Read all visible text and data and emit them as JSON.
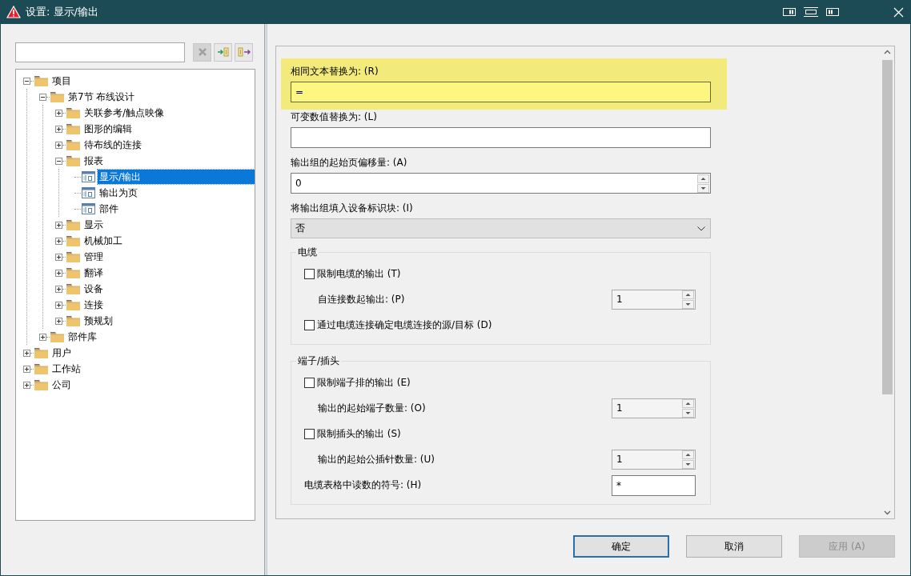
{
  "window": {
    "title": "设置: 显示/输出"
  },
  "filter_toolbar": [
    {
      "kind": "clear",
      "disabled": true
    },
    {
      "kind": "expand",
      "disabled": false
    },
    {
      "kind": "collapse",
      "disabled": false
    }
  ],
  "tree": [
    {
      "label": "项目",
      "kind": "folder",
      "expanded": true,
      "selected": false,
      "children": [
        {
          "label": "第7节 布线设计",
          "kind": "folder",
          "expanded": true,
          "selected": false,
          "children": [
            {
              "label": "关联参考/触点映像",
              "kind": "folder",
              "expanded": false,
              "selected": false
            },
            {
              "label": "图形的编辑",
              "kind": "folder",
              "expanded": false,
              "selected": false
            },
            {
              "label": "待布线的连接",
              "kind": "folder",
              "expanded": false,
              "selected": false
            },
            {
              "label": "报表",
              "kind": "folder",
              "expanded": true,
              "selected": false,
              "children": [
                {
                  "label": "显示/输出",
                  "kind": "page",
                  "selected": true
                },
                {
                  "label": "输出为页",
                  "kind": "page",
                  "selected": false
                },
                {
                  "label": "部件",
                  "kind": "page",
                  "selected": false
                }
              ]
            },
            {
              "label": "显示",
              "kind": "folder",
              "expanded": false,
              "selected": false
            },
            {
              "label": "机械加工",
              "kind": "folder",
              "expanded": false,
              "selected": false
            },
            {
              "label": "管理",
              "kind": "folder",
              "expanded": false,
              "selected": false
            },
            {
              "label": "翻译",
              "kind": "folder",
              "expanded": false,
              "selected": false
            },
            {
              "label": "设备",
              "kind": "folder",
              "expanded": false,
              "selected": false
            },
            {
              "label": "连接",
              "kind": "folder",
              "expanded": false,
              "selected": false
            },
            {
              "label": "预规划",
              "kind": "folder",
              "expanded": false,
              "selected": false
            }
          ]
        },
        {
          "label": "部件库",
          "kind": "folder",
          "expanded": false,
          "selected": false
        }
      ]
    },
    {
      "label": "用户",
      "kind": "folder",
      "expanded": false,
      "selected": false
    },
    {
      "label": "工作站",
      "kind": "folder",
      "expanded": false,
      "selected": false
    },
    {
      "label": "公司",
      "kind": "folder",
      "expanded": false,
      "selected": false
    }
  ],
  "form": [
    {
      "kind": "text",
      "label": "相同文本替换为: (R)",
      "value": "=",
      "highlighted": true
    },
    {
      "kind": "text",
      "label": "可变数值替换为: (L)",
      "highlighted": false
    },
    {
      "kind": "spin",
      "label": "输出组的起始页偏移量: (A)",
      "value": "0"
    },
    {
      "kind": "select",
      "label": "将输出组填入设备标识块: (I)",
      "value": "否"
    },
    {
      "kind": "group",
      "title": "电缆",
      "items": [
        {
          "kind": "checkbox",
          "label": "限制电缆的输出 (T)",
          "checked": false
        },
        {
          "kind": "spin",
          "label": "自连接数起输出: (P)",
          "value": "1",
          "disabled": true
        },
        {
          "kind": "checkbox",
          "label": "通过电缆连接确定电缆连接的源/目标 (D)",
          "checked": false
        }
      ]
    },
    {
      "kind": "group",
      "title": "端子/插头",
      "items": [
        {
          "kind": "checkbox",
          "label": "限制端子排的输出 (E)",
          "checked": false
        },
        {
          "kind": "spin",
          "label": "输出的起始端子数量: (O)",
          "value": "1",
          "disabled": true
        },
        {
          "kind": "checkbox",
          "label": "限制插头的输出 (S)",
          "checked": false
        },
        {
          "kind": "spin",
          "label": "输出的起始公插针数量: (U)",
          "value": "1",
          "disabled": true
        },
        {
          "kind": "text",
          "label": "电缆表格中读数的符号: (H)",
          "value": "*"
        }
      ]
    }
  ],
  "buttons": [
    {
      "label": "确定",
      "default": true,
      "disabled": false
    },
    {
      "label": "取消",
      "default": false,
      "disabled": false
    },
    {
      "label": "应用 (A)",
      "default": false,
      "disabled": true
    }
  ]
}
